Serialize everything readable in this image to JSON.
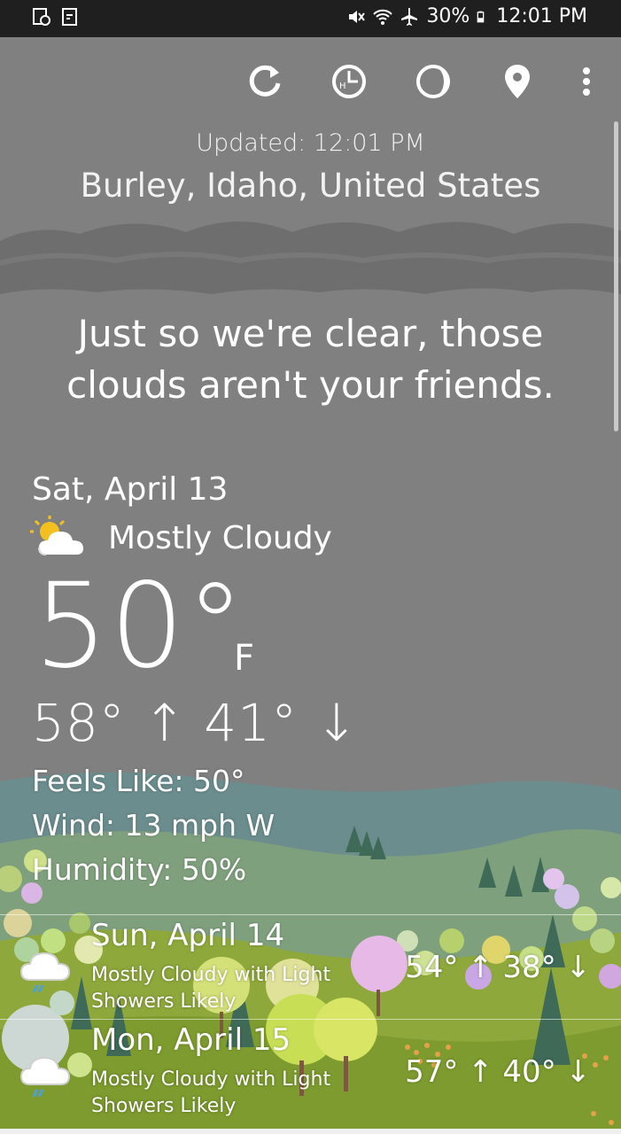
{
  "status_bar": {
    "battery": "30%",
    "time": "12:01 PM"
  },
  "toolbar": {
    "icons": [
      "refresh-icon",
      "history-icon",
      "theme-icon",
      "location-pin-icon",
      "more-vert-icon"
    ]
  },
  "header": {
    "updated": "Updated: 12:01 PM",
    "location": "Burley, Idaho, United States"
  },
  "quip": "Just so we're clear, those clouds aren't your friends.",
  "current": {
    "date": "Sat, April 13",
    "condition": "Mostly Cloudy",
    "condition_icon": "partly-cloudy-icon",
    "temp": "50°",
    "unit": "F",
    "hilo": "58° ↑ 41° ↓",
    "feels_like": "Feels Like: 50°",
    "wind": "Wind: 13 mph W",
    "humidity": "Humidity: 50%"
  },
  "forecast": [
    {
      "day": "Sun, April 14",
      "desc_line1": "Mostly Cloudy with Light",
      "desc_line2": "Showers Likely",
      "temps": "54° ↑ 38° ↓",
      "icon": "cloud-rain-icon"
    },
    {
      "day": "Mon, April 15",
      "desc_line1": "Mostly Cloudy with Light",
      "desc_line2": "Showers Likely",
      "temps": "57° ↑ 40° ↓",
      "icon": "cloud-rain-icon"
    }
  ],
  "colors": {
    "sky": "#808080",
    "status_bar": "#1f1f1f",
    "hills_far": "#6b8d8e",
    "grass": "#8ea83c"
  }
}
